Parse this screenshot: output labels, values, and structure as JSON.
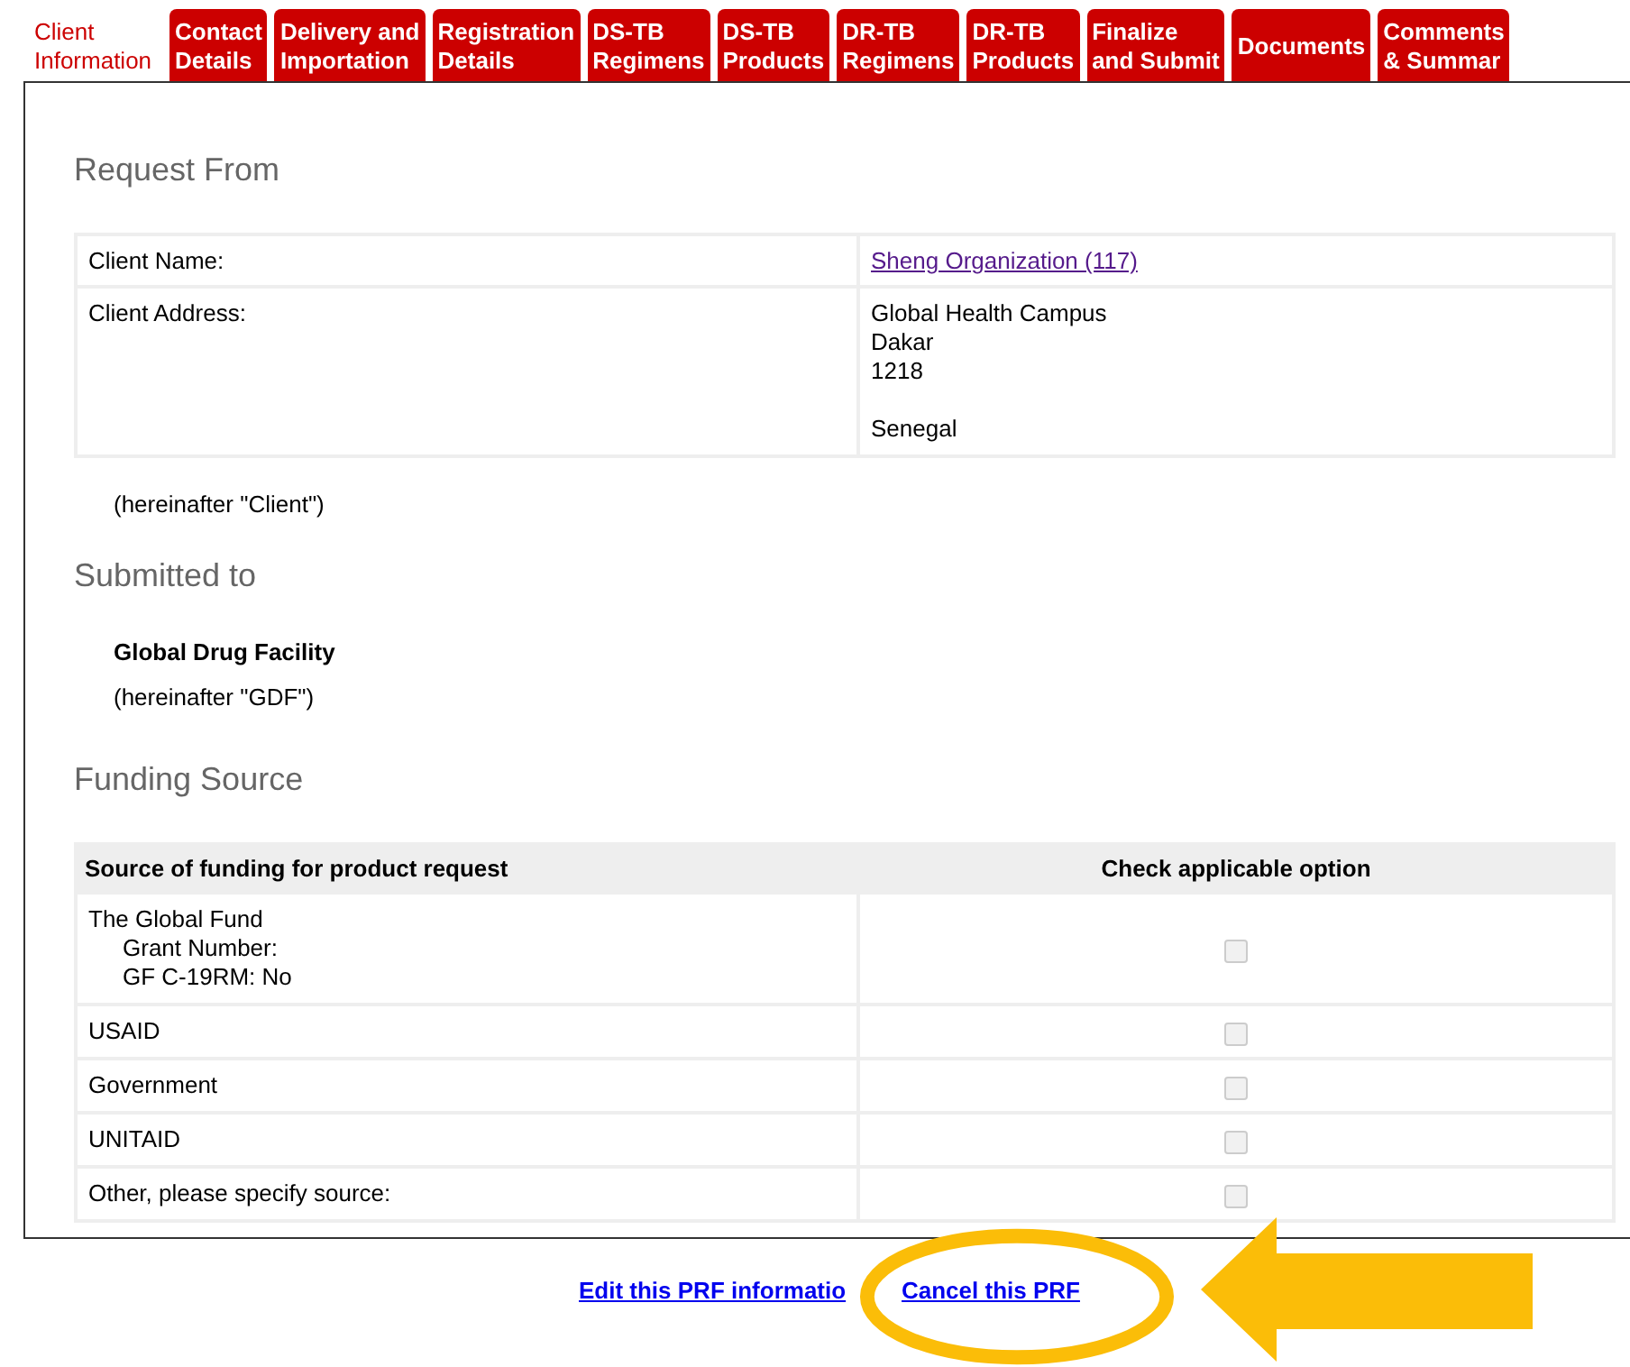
{
  "tabs": [
    {
      "label": "Client\nInformation",
      "selected": true
    },
    {
      "label": "Contact\nDetails",
      "selected": false
    },
    {
      "label": "Delivery and\nImportation",
      "selected": false
    },
    {
      "label": "Registration\nDetails",
      "selected": false
    },
    {
      "label": "DS-TB\nRegimens",
      "selected": false
    },
    {
      "label": "DS-TB\nProducts",
      "selected": false
    },
    {
      "label": "DR-TB\nRegimens",
      "selected": false
    },
    {
      "label": "DR-TB\nProducts",
      "selected": false
    },
    {
      "label": "Finalize\nand Submit",
      "selected": false
    },
    {
      "label": "Documents",
      "selected": false
    },
    {
      "label": "Comments\n& Summar",
      "selected": false
    }
  ],
  "request_from": {
    "heading": "Request From",
    "rows": [
      {
        "label": "Client Name:",
        "value": "Sheng Organization (117)",
        "kind": "link"
      },
      {
        "label": "Client Address:",
        "value": "Global Health Campus\nDakar\n1218\n\nSenegal",
        "kind": "text"
      }
    ],
    "note": "(hereinafter \"Client\")"
  },
  "submitted_to": {
    "heading": "Submitted to",
    "name": "Global Drug Facility",
    "note": "(hereinafter \"GDF\")"
  },
  "funding_source": {
    "heading": "Funding Source",
    "columns": [
      "Source of funding for product request",
      "Check applicable option"
    ],
    "rows": [
      {
        "name": "The Global Fund",
        "details": [
          "Grant Number:",
          "GF C-19RM: No"
        ],
        "checked": false,
        "disabled": true
      },
      {
        "name": "USAID",
        "checked": false,
        "disabled": true
      },
      {
        "name": "Government",
        "checked": false,
        "disabled": true
      },
      {
        "name": "UNITAID",
        "checked": false,
        "disabled": true
      },
      {
        "name": "Other, please specify source:",
        "checked": false,
        "disabled": true
      }
    ]
  },
  "footer_links": [
    "Edit this PRF informatio",
    "Cancel this PRF"
  ]
}
